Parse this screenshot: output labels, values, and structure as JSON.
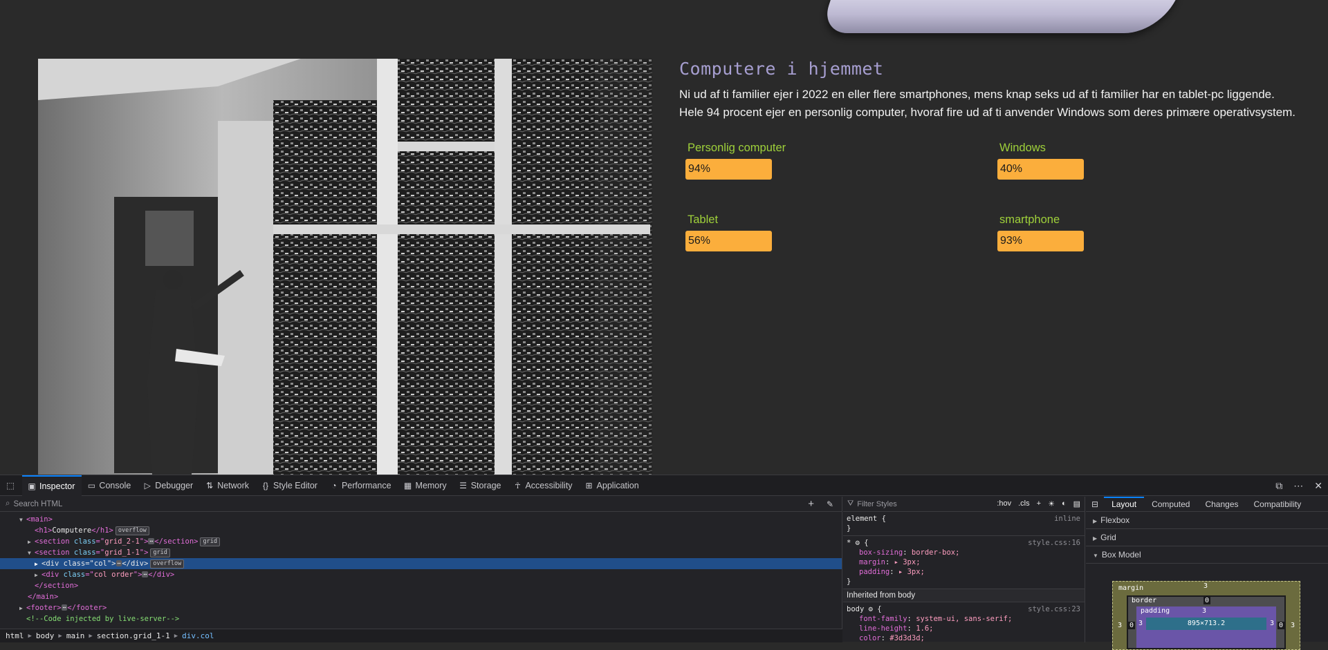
{
  "page": {
    "heading": "Computere i hjemmet",
    "paragraph": "Ni ud af ti familier  ejer  i 2022 en eller flere smartphones, mens knap seks ud af ti familier har en tablet-pc liggende. Hele 94 procent ejer en personlig computer, hvoraf fire ud af ti anvender Windows som deres primære operativsystem.",
    "stats": [
      {
        "label": "Personlig computer",
        "value": "94%"
      },
      {
        "label": "Windows",
        "value": "40%"
      },
      {
        "label": "Tablet",
        "value": "56%"
      },
      {
        "label": "smartphone",
        "value": "93%"
      }
    ],
    "colors": {
      "background": "#2a2a2a",
      "heading": "#a79fd1",
      "stat_label": "#9fd13a",
      "stat_bar": "#fbae3c"
    }
  },
  "devtools": {
    "tabs": [
      {
        "label": "Inspector",
        "icon": "inspector-icon"
      },
      {
        "label": "Console",
        "icon": "console-icon"
      },
      {
        "label": "Debugger",
        "icon": "debugger-icon"
      },
      {
        "label": "Network",
        "icon": "network-icon"
      },
      {
        "label": "Style Editor",
        "icon": "style-editor-icon"
      },
      {
        "label": "Performance",
        "icon": "performance-icon"
      },
      {
        "label": "Memory",
        "icon": "memory-icon"
      },
      {
        "label": "Storage",
        "icon": "storage-icon"
      },
      {
        "label": "Accessibility",
        "icon": "accessibility-icon"
      },
      {
        "label": "Application",
        "icon": "application-icon"
      }
    ],
    "search_placeholder": "Search HTML",
    "tree": {
      "main_tag": "main",
      "h1_tag": "h1",
      "h1_text": "Computere",
      "h1_close": "/h1",
      "badge_overflow": "overflow",
      "badge_grid": "grid",
      "section1_class": "grid_2-1",
      "section2_class": "grid_1-1",
      "div_col_class": "col",
      "div_col_order_class": "col order",
      "section_tag": "section",
      "section_close": "/section",
      "div_tag": "div",
      "div_close": "/div",
      "main_close": "/main",
      "footer_tag": "footer",
      "footer_close": "/footer",
      "comment": "<!--Code injected by live-server-->",
      "attr_class": "class",
      "ellipsis": "⋯"
    },
    "breadcrumb": [
      "html",
      "body",
      "main",
      "section.grid_1-1",
      "div.col"
    ],
    "styles": {
      "filter_placeholder": "Filter Styles",
      "hov": ":hov",
      "cls": ".cls",
      "element_selector": "element {",
      "element_source": "inline",
      "star_selector": "* ⚙ {",
      "star_source": "style.css:16",
      "star_props": [
        {
          "name": "box-sizing",
          "value": "border-box;"
        },
        {
          "name": "margin",
          "value": "▸ 3px;"
        },
        {
          "name": "padding",
          "value": "▸ 3px;"
        }
      ],
      "inherited_label": "Inherited from body",
      "body_selector": "body ⚙ {",
      "body_source": "style.css:23",
      "body_props": [
        {
          "name": "font-family",
          "value": "system-ui, sans-serif;"
        },
        {
          "name": "line-height",
          "value": "1.6;"
        },
        {
          "name": "color",
          "value": "#3d3d3d;"
        }
      ],
      "close_brace": "}"
    },
    "layout": {
      "tabs": [
        "Layout",
        "Computed",
        "Changes",
        "Compatibility"
      ],
      "sections": [
        "Flexbox",
        "Grid",
        "Box Model"
      ],
      "box_model": {
        "margin_label": "margin",
        "border_label": "border",
        "padding_label": "padding",
        "margin_value": "3",
        "border_value": "0",
        "padding_value": "3",
        "content_size": "895×713.2"
      }
    }
  }
}
